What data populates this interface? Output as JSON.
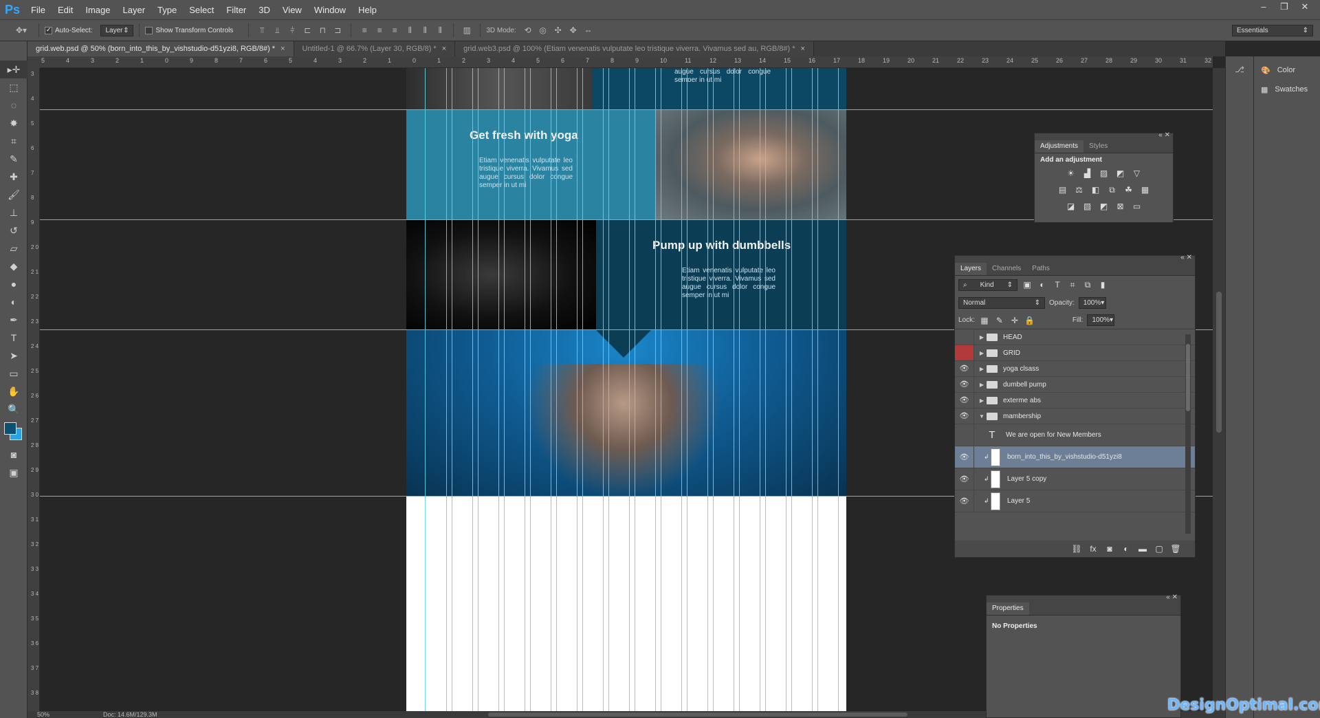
{
  "app": {
    "logo": "Ps"
  },
  "menu": [
    "File",
    "Edit",
    "Image",
    "Layer",
    "Type",
    "Select",
    "Filter",
    "3D",
    "View",
    "Window",
    "Help"
  ],
  "window_controls": [
    "–",
    "❐",
    "✕"
  ],
  "options_bar": {
    "auto_select_label": "Auto-Select:",
    "auto_select_checked": true,
    "auto_select_target": "Layer",
    "show_transform_label": "Show Transform Controls",
    "mode_3d_label": "3D Mode:",
    "workspace": "Essentials"
  },
  "tabs": [
    {
      "label": "grid.web.psd @ 50% (born_into_this_by_vishstudio-d51yzi8, RGB/8#) *",
      "close": "×"
    },
    {
      "label": "Untitled-1 @ 66.7% (Layer 30, RGB/8) *",
      "close": "×"
    },
    {
      "label": "grid.web3.psd @ 100% (Etiam venenatis vulputate leo tristique viverra. Vivamus sed au, RGB/8#) *",
      "close": "×"
    }
  ],
  "hruler_numbers": [
    "5",
    "4",
    "3",
    "2",
    "1",
    "0",
    "9",
    "8",
    "7",
    "6",
    "5",
    "4",
    "3",
    "2",
    "1",
    "0",
    "1",
    "2",
    "3",
    "4",
    "5",
    "6",
    "7",
    "8",
    "9",
    "10",
    "11",
    "12",
    "13",
    "14",
    "15",
    "16",
    "17",
    "18",
    "19",
    "20",
    "21",
    "22",
    "23",
    "24",
    "25",
    "26",
    "27",
    "28",
    "29",
    "30",
    "31",
    "32"
  ],
  "vruler_numbers": [
    "3",
    "4",
    "5",
    "6",
    "7",
    "8",
    "9",
    "2 0",
    "2 1",
    "2 2",
    "2 3",
    "2 4",
    "2 5",
    "2 6",
    "2 7",
    "2 8",
    "2 9",
    "3 0",
    "3 1",
    "3 2",
    "3 3",
    "3 4",
    "3 5",
    "3 6",
    "3 7",
    "3 8"
  ],
  "document": {
    "top_text": "augue cursus dolor congue semper in ut mi",
    "yoga": {
      "title": "Get fresh with yoga",
      "body": "Etiam venenatis vulputate leo tristique viverra. Vivamus sed augue cursus dolor congue semper in ut mi"
    },
    "dumbbells": {
      "title": "Pump up with dumbbells",
      "body": "Etiam venenatis vulputate leo tristique viverra. Vivamus sed augue cursus dolor congue semper in ut mi"
    },
    "colors": {
      "teal": "#24809b",
      "navy": "#0c3d58",
      "blue": "#1169a6"
    }
  },
  "dock": {
    "items": [
      {
        "label": "Color",
        "icon": "color-icon"
      },
      {
        "label": "Swatches",
        "icon": "swatches-icon"
      }
    ]
  },
  "adjustments_panel": {
    "tabs": [
      "Adjustments",
      "Styles"
    ],
    "heading": "Add an adjustment"
  },
  "layers_panel": {
    "tabs": [
      "Layers",
      "Channels",
      "Paths"
    ],
    "filter": "Kind",
    "blend_mode": "Normal",
    "opacity_label": "Opacity:",
    "opacity": "100%",
    "lock_label": "Lock:",
    "fill_label": "Fill:",
    "fill": "100%",
    "layers": [
      {
        "name": "HEAD",
        "type": "group",
        "visible": false,
        "expanded": false
      },
      {
        "name": "GRID",
        "type": "group",
        "visible": false,
        "expanded": false,
        "color": "#b23a3a"
      },
      {
        "name": "yoga clsass",
        "type": "group",
        "visible": true,
        "expanded": false
      },
      {
        "name": "dumbell pump",
        "type": "group",
        "visible": true,
        "expanded": false
      },
      {
        "name": "exterme abs",
        "type": "group",
        "visible": true,
        "expanded": false
      },
      {
        "name": "mambership",
        "type": "group",
        "visible": true,
        "expanded": true
      },
      {
        "name": "We are open for New Members",
        "type": "text",
        "visible": false
      },
      {
        "name": "born_into_this_by_vishstudio-d51yzi8",
        "type": "pixel",
        "visible": true,
        "selected": true
      },
      {
        "name": "Layer 5 copy",
        "type": "pixel",
        "visible": true
      },
      {
        "name": "Layer 5",
        "type": "pixel",
        "visible": true
      }
    ]
  },
  "properties_panel": {
    "tab": "Properties",
    "message": "No Properties"
  },
  "status": {
    "zoom": "50%",
    "doc": "Doc: 14.6M/129.3M"
  },
  "watermark": "DesignOptimal.com"
}
